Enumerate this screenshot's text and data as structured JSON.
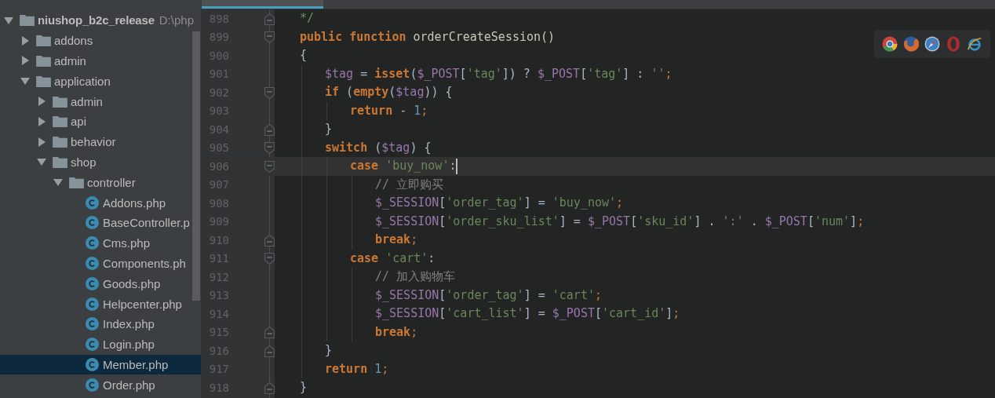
{
  "project_tree": {
    "items": [
      {
        "kind": "folder",
        "label": "niushop_b2c_release",
        "path": "D:\\php",
        "expanded": true,
        "selected": false,
        "children": [
          {
            "kind": "folder",
            "label": "addons",
            "expanded": false,
            "selected": false
          },
          {
            "kind": "folder",
            "label": "admin",
            "expanded": false,
            "selected": false
          },
          {
            "kind": "folder",
            "label": "application",
            "expanded": true,
            "selected": false,
            "children": [
              {
                "kind": "folder",
                "label": "admin",
                "expanded": false,
                "selected": false
              },
              {
                "kind": "folder",
                "label": "api",
                "expanded": false,
                "selected": false
              },
              {
                "kind": "folder",
                "label": "behavior",
                "expanded": false,
                "selected": false
              },
              {
                "kind": "folder",
                "label": "shop",
                "expanded": true,
                "selected": false,
                "children": [
                  {
                    "kind": "folder",
                    "label": "controller",
                    "expanded": true,
                    "selected": false,
                    "children": [
                      {
                        "kind": "file",
                        "label": "Addons.php",
                        "selected": false
                      },
                      {
                        "kind": "file",
                        "label": "BaseController.p",
                        "selected": false
                      },
                      {
                        "kind": "file",
                        "label": "Cms.php",
                        "selected": false
                      },
                      {
                        "kind": "file",
                        "label": "Components.ph",
                        "selected": false
                      },
                      {
                        "kind": "file",
                        "label": "Goods.php",
                        "selected": false
                      },
                      {
                        "kind": "file",
                        "label": "Helpcenter.php",
                        "selected": false
                      },
                      {
                        "kind": "file",
                        "label": "Index.php",
                        "selected": false
                      },
                      {
                        "kind": "file",
                        "label": "Login.php",
                        "selected": false
                      },
                      {
                        "kind": "file",
                        "label": "Member.php",
                        "selected": true
                      },
                      {
                        "kind": "file",
                        "label": "Order.php",
                        "selected": false
                      }
                    ]
                  }
                ]
              }
            ]
          }
        ]
      }
    ]
  },
  "editor": {
    "lines": [
      {
        "number": "898",
        "fold_open": false,
        "fold_close": true,
        "current": false,
        "segments": [
          {
            "text": "*/",
            "kind": "doc"
          }
        ]
      },
      {
        "number": "899",
        "fold_open": true,
        "fold_close": false,
        "current": false,
        "segments": [
          {
            "text": "public function ",
            "kind": "keyword"
          },
          {
            "text": "orderCreateSession()",
            "kind": "function"
          }
        ]
      },
      {
        "number": "900",
        "fold_open": false,
        "fold_close": false,
        "current": false,
        "segments": [
          {
            "text": "{",
            "kind": "plain"
          }
        ],
        "children": [
          {
            "number": "901",
            "fold_open": false,
            "fold_close": false,
            "current": false,
            "segments": [
              {
                "text": "$tag",
                "kind": "variable"
              },
              {
                "text": " = ",
                "kind": "plain"
              },
              {
                "text": "isset",
                "kind": "keyword"
              },
              {
                "text": "(",
                "kind": "plain"
              },
              {
                "text": "$_POST",
                "kind": "variable"
              },
              {
                "text": "[",
                "kind": "plain"
              },
              {
                "text": "'tag'",
                "kind": "string"
              },
              {
                "text": "]) ? ",
                "kind": "plain"
              },
              {
                "text": "$_POST",
                "kind": "variable"
              },
              {
                "text": "[",
                "kind": "plain"
              },
              {
                "text": "'tag'",
                "kind": "string"
              },
              {
                "text": "] : ",
                "kind": "plain"
              },
              {
                "text": "''",
                "kind": "string"
              },
              {
                "text": ";",
                "kind": "semicolon"
              }
            ]
          },
          {
            "number": "902",
            "fold_open": true,
            "fold_close": false,
            "current": false,
            "segments": [
              {
                "text": "if",
                "kind": "keyword"
              },
              {
                "text": " (",
                "kind": "plain"
              },
              {
                "text": "empty",
                "kind": "keyword"
              },
              {
                "text": "(",
                "kind": "plain"
              },
              {
                "text": "$tag",
                "kind": "variable"
              },
              {
                "text": ")) {",
                "kind": "plain"
              }
            ],
            "children": [
              {
                "number": "903",
                "fold_open": false,
                "fold_close": false,
                "current": false,
                "segments": [
                  {
                    "text": "return",
                    "kind": "keyword"
                  },
                  {
                    "text": " - ",
                    "kind": "plain"
                  },
                  {
                    "text": "1",
                    "kind": "number"
                  },
                  {
                    "text": ";",
                    "kind": "semicolon"
                  }
                ]
              }
            ]
          },
          {
            "number": "904",
            "fold_open": false,
            "fold_close": true,
            "current": false,
            "segments": [
              {
                "text": "}",
                "kind": "plain"
              }
            ]
          },
          {
            "number": "905",
            "fold_open": true,
            "fold_close": false,
            "current": false,
            "segments": [
              {
                "text": "switch",
                "kind": "keyword"
              },
              {
                "text": " (",
                "kind": "plain"
              },
              {
                "text": "$tag",
                "kind": "variable"
              },
              {
                "text": ") {",
                "kind": "plain"
              }
            ],
            "children": [
              {
                "number": "906",
                "fold_open": true,
                "fold_close": false,
                "current": true,
                "segments": [
                  {
                    "text": "case ",
                    "kind": "keyword"
                  },
                  {
                    "text": "'buy_now'",
                    "kind": "string"
                  },
                  {
                    "text": ":",
                    "kind": "plain"
                  }
                ],
                "children": [
                  {
                    "number": "907",
                    "fold_open": false,
                    "fold_close": false,
                    "current": false,
                    "segments": [
                      {
                        "text": "// 立即购买",
                        "kind": "comment"
                      }
                    ]
                  },
                  {
                    "number": "908",
                    "fold_open": false,
                    "fold_close": false,
                    "current": false,
                    "segments": [
                      {
                        "text": "$_SESSION",
                        "kind": "variable"
                      },
                      {
                        "text": "[",
                        "kind": "plain"
                      },
                      {
                        "text": "'order_tag'",
                        "kind": "string"
                      },
                      {
                        "text": "] = ",
                        "kind": "plain"
                      },
                      {
                        "text": "'buy_now'",
                        "kind": "string"
                      },
                      {
                        "text": ";",
                        "kind": "semicolon"
                      }
                    ]
                  },
                  {
                    "number": "909",
                    "fold_open": false,
                    "fold_close": false,
                    "current": false,
                    "segments": [
                      {
                        "text": "$_SESSION",
                        "kind": "variable"
                      },
                      {
                        "text": "[",
                        "kind": "plain"
                      },
                      {
                        "text": "'order_sku_list'",
                        "kind": "string"
                      },
                      {
                        "text": "] = ",
                        "kind": "plain"
                      },
                      {
                        "text": "$_POST",
                        "kind": "variable"
                      },
                      {
                        "text": "[",
                        "kind": "plain"
                      },
                      {
                        "text": "'sku_id'",
                        "kind": "string"
                      },
                      {
                        "text": "] . ",
                        "kind": "plain"
                      },
                      {
                        "text": "':'",
                        "kind": "string"
                      },
                      {
                        "text": " . ",
                        "kind": "plain"
                      },
                      {
                        "text": "$_POST",
                        "kind": "variable"
                      },
                      {
                        "text": "[",
                        "kind": "plain"
                      },
                      {
                        "text": "'num'",
                        "kind": "string"
                      },
                      {
                        "text": "]",
                        "kind": "plain"
                      },
                      {
                        "text": ";",
                        "kind": "semicolon"
                      }
                    ]
                  },
                  {
                    "number": "910",
                    "fold_open": false,
                    "fold_close": true,
                    "current": false,
                    "segments": [
                      {
                        "text": "break",
                        "kind": "keyword"
                      },
                      {
                        "text": ";",
                        "kind": "semicolon"
                      }
                    ]
                  }
                ]
              },
              {
                "number": "911",
                "fold_open": true,
                "fold_close": false,
                "current": false,
                "segments": [
                  {
                    "text": "case ",
                    "kind": "keyword"
                  },
                  {
                    "text": "'cart'",
                    "kind": "string"
                  },
                  {
                    "text": ":",
                    "kind": "plain"
                  }
                ],
                "children": [
                  {
                    "number": "912",
                    "fold_open": false,
                    "fold_close": false,
                    "current": false,
                    "segments": [
                      {
                        "text": "// 加入购物车",
                        "kind": "comment"
                      }
                    ]
                  },
                  {
                    "number": "913",
                    "fold_open": false,
                    "fold_close": false,
                    "current": false,
                    "segments": [
                      {
                        "text": "$_SESSION",
                        "kind": "variable"
                      },
                      {
                        "text": "[",
                        "kind": "plain"
                      },
                      {
                        "text": "'order_tag'",
                        "kind": "string"
                      },
                      {
                        "text": "] = ",
                        "kind": "plain"
                      },
                      {
                        "text": "'cart'",
                        "kind": "string"
                      },
                      {
                        "text": ";",
                        "kind": "semicolon"
                      }
                    ]
                  },
                  {
                    "number": "914",
                    "fold_open": false,
                    "fold_close": false,
                    "current": false,
                    "segments": [
                      {
                        "text": "$_SESSION",
                        "kind": "variable"
                      },
                      {
                        "text": "[",
                        "kind": "plain"
                      },
                      {
                        "text": "'cart_list'",
                        "kind": "string"
                      },
                      {
                        "text": "] = ",
                        "kind": "plain"
                      },
                      {
                        "text": "$_POST",
                        "kind": "variable"
                      },
                      {
                        "text": "[",
                        "kind": "plain"
                      },
                      {
                        "text": "'cart_id'",
                        "kind": "string"
                      },
                      {
                        "text": "]",
                        "kind": "plain"
                      },
                      {
                        "text": ";",
                        "kind": "semicolon"
                      }
                    ]
                  },
                  {
                    "number": "915",
                    "fold_open": false,
                    "fold_close": true,
                    "current": false,
                    "segments": [
                      {
                        "text": "break",
                        "kind": "keyword"
                      },
                      {
                        "text": ";",
                        "kind": "semicolon"
                      }
                    ]
                  }
                ]
              }
            ]
          },
          {
            "number": "916",
            "fold_open": false,
            "fold_close": true,
            "current": false,
            "segments": [
              {
                "text": "}",
                "kind": "plain"
              }
            ]
          },
          {
            "number": "917",
            "fold_open": false,
            "fold_close": false,
            "current": false,
            "segments": [
              {
                "text": "return ",
                "kind": "keyword"
              },
              {
                "text": "1",
                "kind": "number"
              },
              {
                "text": ";",
                "kind": "semicolon"
              }
            ]
          }
        ]
      },
      {
        "number": "918",
        "fold_open": false,
        "fold_close": true,
        "current": false,
        "segments": [
          {
            "text": "}",
            "kind": "plain"
          }
        ]
      }
    ]
  }
}
